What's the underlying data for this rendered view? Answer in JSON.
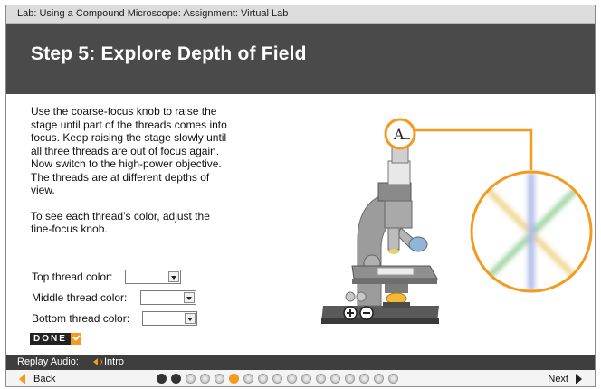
{
  "breadcrumb": "Lab: Using a Compound Microscope: Assignment: Virtual Lab",
  "step_title": "Step 5: Explore Depth of Field",
  "instructions": {
    "para1": "Use the coarse-focus knob to raise the stage until part of the threads comes into focus. Keep raising the stage slowly until all three threads are out of focus again. Now switch to the high-power objective. The threads are at different depths of view.",
    "para2": "To see each thread’s color, adjust the fine-focus knob."
  },
  "form": {
    "top_label": "Top thread color:",
    "middle_label": "Middle thread color:",
    "bottom_label": "Bottom thread color:",
    "top_value": "",
    "middle_value": "",
    "bottom_value": "",
    "done_label": "DONE"
  },
  "audio": {
    "replay_label": "Replay Audio:",
    "intro_label": "Intro"
  },
  "nav": {
    "back_label": "Back",
    "next_label": "Next",
    "steps": [
      "visited",
      "visited",
      "todo",
      "todo",
      "todo",
      "current",
      "todo",
      "todo",
      "todo",
      "todo",
      "todo",
      "todo",
      "todo",
      "todo",
      "todo",
      "todo",
      "todo"
    ]
  },
  "colors": {
    "accent": "#f49a1c",
    "banner": "#4a4a4a",
    "bars": "#3e3e3e"
  },
  "icons": [
    "speaker-icon",
    "back-arrow-icon",
    "next-arrow-icon",
    "check-icon",
    "plus-icon",
    "minus-icon"
  ]
}
